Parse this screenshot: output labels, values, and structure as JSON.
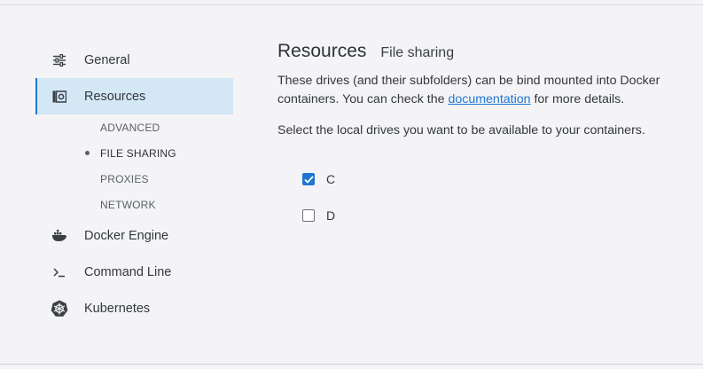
{
  "sidebar": {
    "items": [
      {
        "label": "General",
        "icon": "sliders-icon"
      },
      {
        "label": "Resources",
        "icon": "resources-icon",
        "active": true
      },
      {
        "label": "Docker Engine",
        "icon": "whale-icon"
      },
      {
        "label": "Command Line",
        "icon": "terminal-icon"
      },
      {
        "label": "Kubernetes",
        "icon": "kubernetes-icon"
      }
    ],
    "sub_items": [
      "ADVANCED",
      "FILE SHARING",
      "PROXIES",
      "NETWORK"
    ],
    "current_sub_item": "FILE SHARING"
  },
  "main": {
    "title": "Resources",
    "subtitle": "File sharing",
    "desc_before": "These drives (and their subfolders) can be bind mounted into Docker containers. You can check the ",
    "desc_link": "documentation",
    "desc_after": " for more details.",
    "prompt": "Select the local drives you want to be available to your containers.",
    "drives": [
      {
        "label": "C",
        "checked": true
      },
      {
        "label": "D",
        "checked": false
      }
    ]
  },
  "colors": {
    "accent": "#1f76d2",
    "active_bg": "#d3e7f5",
    "background": "#f4f4f6"
  }
}
